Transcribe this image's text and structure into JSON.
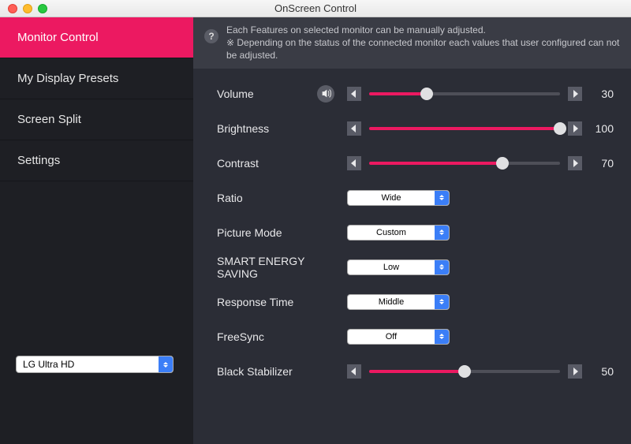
{
  "window": {
    "title": "OnScreen Control"
  },
  "sidebar": {
    "items": [
      {
        "label": "Monitor Control",
        "active": true
      },
      {
        "label": "My Display Presets",
        "active": false
      },
      {
        "label": "Screen Split",
        "active": false
      },
      {
        "label": "Settings",
        "active": false
      }
    ],
    "device_selected": "LG Ultra HD"
  },
  "banner": {
    "line1": "Each Features on selected monitor can be manually adjusted.",
    "line2": "※ Depending on the status of the connected monitor each values that user configured can not be adjusted."
  },
  "controls": {
    "volume": {
      "label": "Volume",
      "type": "slider",
      "value": 30,
      "max": 100
    },
    "brightness": {
      "label": "Brightness",
      "type": "slider",
      "value": 100,
      "max": 100
    },
    "contrast": {
      "label": "Contrast",
      "type": "slider",
      "value": 70,
      "max": 100
    },
    "ratio": {
      "label": "Ratio",
      "type": "select",
      "value": "Wide"
    },
    "picture_mode": {
      "label": "Picture Mode",
      "type": "select",
      "value": "Custom"
    },
    "smart_energy": {
      "label": "SMART ENERGY SAVING",
      "type": "select",
      "value": "Low"
    },
    "response_time": {
      "label": "Response Time",
      "type": "select",
      "value": "Middle"
    },
    "freesync": {
      "label": "FreeSync",
      "type": "select",
      "value": "Off"
    },
    "black_stabilizer": {
      "label": "Black Stabilizer",
      "type": "slider",
      "value": 50,
      "max": 100
    }
  },
  "colors": {
    "accent": "#ec1961"
  }
}
